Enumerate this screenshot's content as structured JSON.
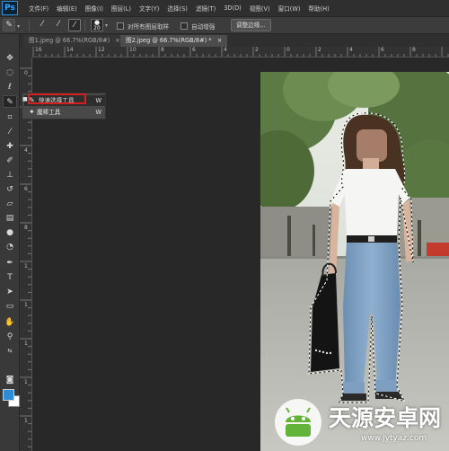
{
  "app": {
    "logo_text": "Ps",
    "logo_color": "#2e8bd6"
  },
  "menu": [
    "文件(F)",
    "编辑(E)",
    "图像(I)",
    "图层(L)",
    "文字(Y)",
    "选择(S)",
    "滤镜(T)",
    "3D(D)",
    "视图(V)",
    "窗口(W)",
    "帮助(H)"
  ],
  "options_bar": {
    "brush_size": "20",
    "sample_all_layers_label": "对所有图层取样",
    "auto_enhance_label": "自动增强",
    "refine_edge_label": "调整边缘..."
  },
  "tabs": [
    {
      "label": "图1.jpeg @ 66.7%(RGB/8#)",
      "close": "×",
      "active": false
    },
    {
      "label": "图2.jpeg @ 66.7%(RGB/8#) *",
      "close": "×",
      "active": true
    }
  ],
  "rulers": {
    "horizontal": [
      "16",
      "14",
      "12",
      "10",
      "8",
      "6",
      "4",
      "2",
      "0",
      "2",
      "4",
      "6",
      "8"
    ],
    "vertical": [
      "0",
      "2",
      "4",
      "6",
      "8",
      "1",
      "1",
      "1",
      "1",
      "1"
    ]
  },
  "tool_flyout": {
    "items": [
      {
        "label": "快速选择工具",
        "shortcut": "W",
        "selected": true
      },
      {
        "label": "魔棒工具",
        "shortcut": "W",
        "selected": false
      }
    ],
    "highlight_color": "#d42020"
  },
  "colors": {
    "foreground": "#2e8bd6",
    "background": "#ffffff"
  },
  "watermark": {
    "brand": "天源安卓网",
    "url": "www.jytyaz.com"
  }
}
